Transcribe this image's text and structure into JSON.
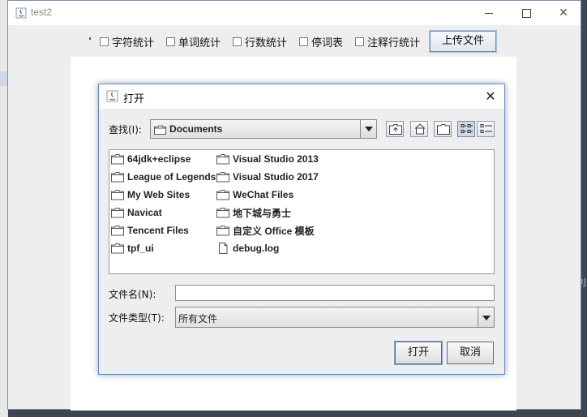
{
  "window": {
    "title": "test2",
    "close_glyph": "✕"
  },
  "toolbar": {
    "checkboxes": [
      {
        "label": "字符统计",
        "checked": false
      },
      {
        "label": "单词统计",
        "checked": false
      },
      {
        "label": "行数统计",
        "checked": false
      },
      {
        "label": "停词表",
        "checked": false
      },
      {
        "label": "注释行统计",
        "checked": false
      }
    ],
    "upload_label": "上传文件"
  },
  "dialog": {
    "title": "打开",
    "close_glyph": "✕",
    "look_in_label": "查找(I):",
    "look_in_value": "Documents",
    "files": [
      {
        "name": "64jdk+eclipse",
        "type": "folder"
      },
      {
        "name": "League of Legends",
        "type": "folder"
      },
      {
        "name": "My Web Sites",
        "type": "folder"
      },
      {
        "name": "Navicat",
        "type": "folder"
      },
      {
        "name": "Tencent Files",
        "type": "folder"
      },
      {
        "name": "tpf_ui",
        "type": "folder"
      },
      {
        "name": "Visual Studio 2013",
        "type": "folder"
      },
      {
        "name": "Visual Studio 2017",
        "type": "folder"
      },
      {
        "name": "WeChat Files",
        "type": "folder"
      },
      {
        "name": "地下城与勇士",
        "type": "folder"
      },
      {
        "name": "自定义 Office 模板",
        "type": "folder"
      },
      {
        "name": "debug.log",
        "type": "file"
      }
    ],
    "file_name_label": "文件名(N):",
    "file_name_value": "",
    "file_type_label": "文件类型(T):",
    "file_type_value": "所有文件",
    "open_label": "打开",
    "cancel_label": "取消"
  },
  "colors": {
    "accent_border": "#5d8bc9",
    "window_bg": "#eeeeee"
  }
}
